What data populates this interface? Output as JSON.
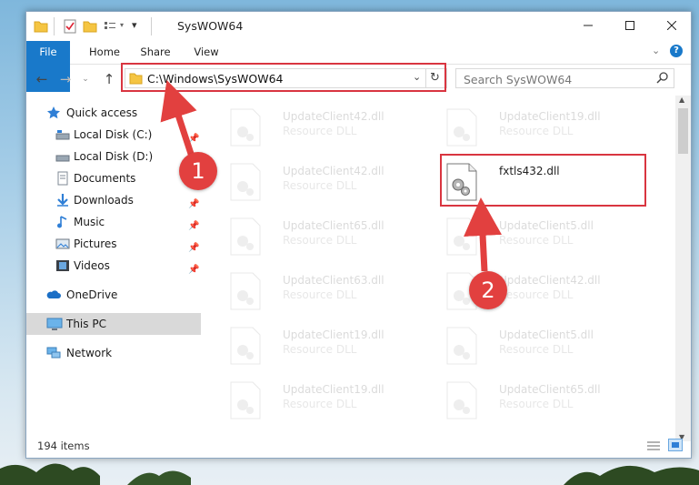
{
  "window": {
    "title": "SysWOW64"
  },
  "ribbon": {
    "tabs": [
      "File",
      "Home",
      "Share",
      "View"
    ]
  },
  "address": {
    "path": "C:\\Windows\\SysWOW64"
  },
  "search": {
    "placeholder": "Search SysWOW64"
  },
  "navpane": {
    "items": [
      {
        "label": "Quick access",
        "icon": "star-icon"
      },
      {
        "label": "Local Disk (C:)",
        "icon": "drive-icon",
        "pinned": true
      },
      {
        "label": "Local Disk (D:)",
        "icon": "drive-icon",
        "pinned": true
      },
      {
        "label": "Documents",
        "icon": "documents-icon",
        "pinned": true
      },
      {
        "label": "Downloads",
        "icon": "downloads-icon",
        "pinned": true
      },
      {
        "label": "Music",
        "icon": "music-icon",
        "pinned": true
      },
      {
        "label": "Pictures",
        "icon": "pictures-icon",
        "pinned": true
      },
      {
        "label": "Videos",
        "icon": "videos-icon",
        "pinned": true
      },
      {
        "label": "OneDrive",
        "icon": "cloud-icon"
      },
      {
        "label": "This PC",
        "icon": "computer-icon",
        "selected": true
      },
      {
        "label": "Network",
        "icon": "network-icon"
      }
    ]
  },
  "files": [
    {
      "name": "UpdateClient42.dll",
      "type": "Resource DLL"
    },
    {
      "name": "UpdateClient19.dll",
      "type": "Resource DLL"
    },
    {
      "name": "UpdateClient42.dll",
      "type": "Resource DLL"
    },
    {
      "name": "fxtls432.dll",
      "type": "",
      "highlight": true
    },
    {
      "name": "UpdateClient65.dll",
      "type": "Resource DLL"
    },
    {
      "name": "UpdateClient5.dll",
      "type": "Resource DLL"
    },
    {
      "name": "UpdateClient63.dll",
      "type": "Resource DLL"
    },
    {
      "name": "UpdateClient42.dll",
      "type": "Resource DLL"
    },
    {
      "name": "UpdateClient19.dll",
      "type": "Resource DLL"
    },
    {
      "name": "UpdateClient5.dll",
      "type": "Resource DLL"
    },
    {
      "name": "UpdateClient19.dll",
      "type": "Resource DLL"
    },
    {
      "name": "UpdateClient65.dll",
      "type": "Resource DLL"
    }
  ],
  "status": {
    "count": "194 items"
  },
  "annotations": {
    "step1": "1",
    "step2": "2",
    "color": "#e2403f"
  },
  "colors": {
    "accent": "#1979ca",
    "selection": "#d9d9d9"
  }
}
